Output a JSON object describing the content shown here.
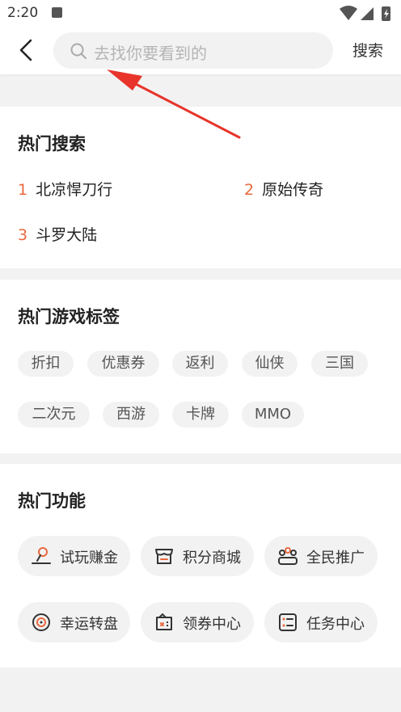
{
  "status_bar": {
    "time": "2:20"
  },
  "header": {
    "search_placeholder": "去找你要看到的",
    "search_button": "搜索"
  },
  "hot_search": {
    "title": "热门搜索",
    "items": [
      {
        "rank": "1",
        "label": "北凉悍刀行"
      },
      {
        "rank": "2",
        "label": "原始传奇"
      },
      {
        "rank": "3",
        "label": "斗罗大陆"
      }
    ]
  },
  "game_tags": {
    "title": "热门游戏标签",
    "tags": [
      "折扣",
      "优惠券",
      "返利",
      "仙侠",
      "三国",
      "二次元",
      "西游",
      "卡牌",
      "MMO"
    ]
  },
  "hot_functions": {
    "title": "热门功能",
    "items": [
      {
        "label": "试玩赚金",
        "icon": "trial-earn-icon"
      },
      {
        "label": "积分商城",
        "icon": "points-store-icon"
      },
      {
        "label": "全民推广",
        "icon": "promotion-icon"
      },
      {
        "label": "幸运转盘",
        "icon": "lucky-wheel-icon"
      },
      {
        "label": "领券中心",
        "icon": "coupon-center-icon"
      },
      {
        "label": "任务中心",
        "icon": "task-center-icon"
      }
    ]
  },
  "colors": {
    "accent_rank": "#e9683e",
    "annotation_arrow": "#e8342a"
  }
}
